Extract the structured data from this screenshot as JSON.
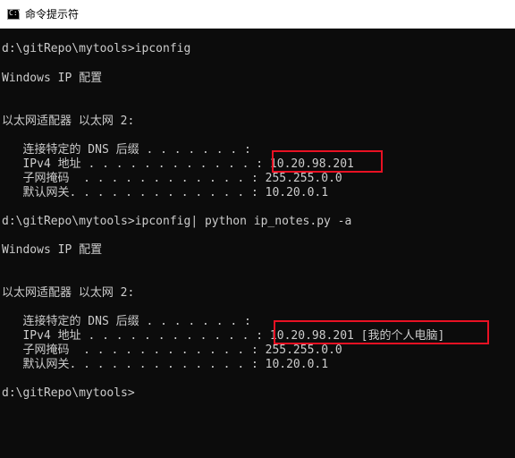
{
  "titlebar": {
    "title": "命令提示符",
    "icon": "cmd-prompt-icon",
    "icon_glyph": "C:\\"
  },
  "console": {
    "lines": [
      "d:\\gitRepo\\mytools>ipconfig",
      "Windows IP 配置",
      "以太网适配器 以太网 2:",
      "   连接特定的 DNS 后缀 . . . . . . . :",
      "   IPv4 地址 . . . . . . . . . . . . : 10.20.98.201",
      "   子网掩码  . . . . . . . . . . . . : 255.255.0.0",
      "   默认网关. . . . . . . . . . . . . : 10.20.0.1",
      "d:\\gitRepo\\mytools>ipconfig| python ip_notes.py -a",
      "Windows IP 配置",
      "以太网适配器 以太网 2:",
      "   连接特定的 DNS 后缀 . . . . . . . :",
      "   IPv4 地址 . . . . . . . . . . . . : 10.20.98.201 [我的个人电脑]",
      "   子网掩码  . . . . . . . . . . . . : 255.255.0.0",
      "   默认网关. . . . . . . . . . . . . : 10.20.0.1",
      "d:\\gitRepo\\mytools>"
    ]
  },
  "colors": {
    "console_bg": "#0c0c0c",
    "console_text": "#cccccc",
    "highlight_box": "#e81123",
    "titlebar_bg": "#ffffff"
  }
}
